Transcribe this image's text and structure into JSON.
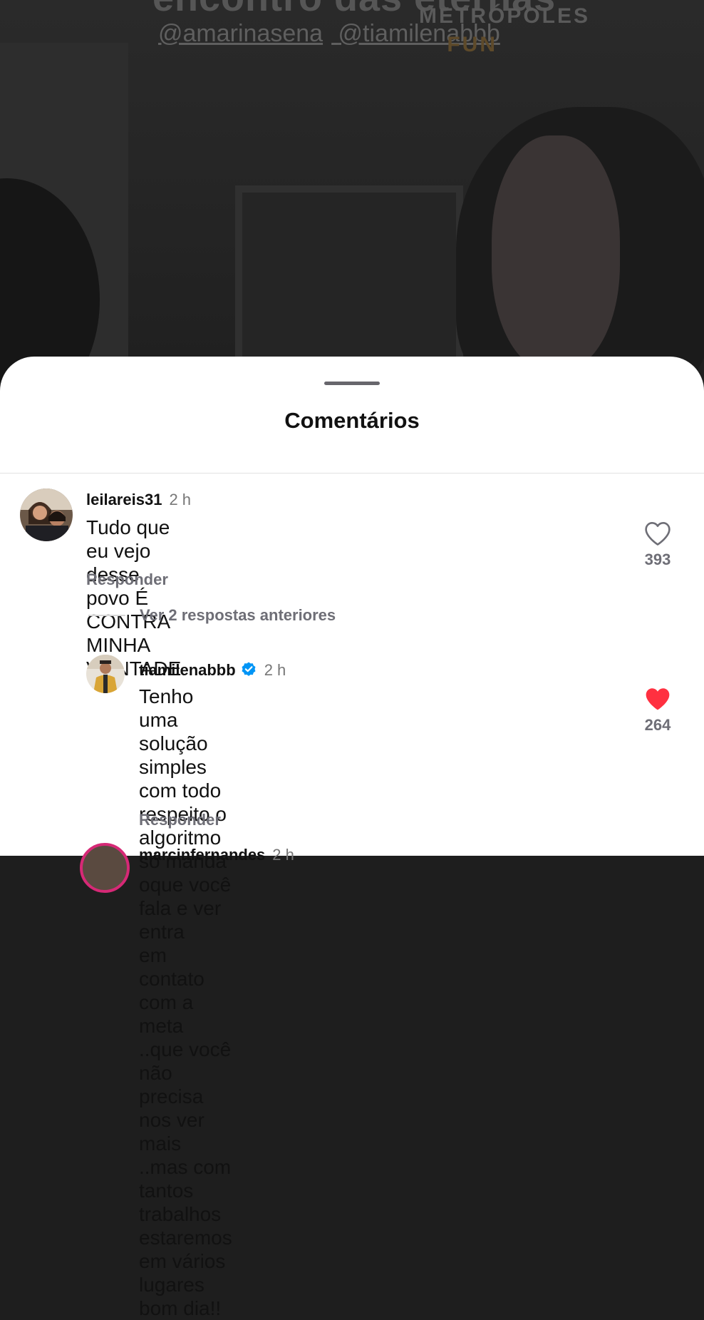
{
  "video": {
    "overlay_title": "encontro das eternas",
    "overlay_tags": [
      "@amarinasena",
      "@tiamilenabbb"
    ],
    "brand_name": "METRÓPOLES",
    "brand_sub": "FUN"
  },
  "sheet": {
    "title": "Comentários"
  },
  "comments": [
    {
      "username": "leilareis31",
      "time": "2 h",
      "text_lines": [
        "Tudo que eu vejo desse povo É CONTRA MINHA",
        "VONTADE"
      ],
      "reply_label": "Responder",
      "likes": "393",
      "liked": false
    }
  ],
  "view_replies_label": "Ver 2 respostas anteriores",
  "replies": [
    {
      "username": "tiamilenabbb",
      "verified": true,
      "time": "2 h",
      "text_lines": [
        "Tenho uma solução simples com todo respeito o",
        "algoritmo só manda oque você fala e ver entra",
        "em contato com a meta ..que você  não precisa",
        "nos ver mais ..mas com tantos trabalhos",
        "estaremos em vários lugares bom dia!!"
      ],
      "reply_label": "Responder",
      "likes": "264",
      "liked": true
    }
  ],
  "next_comment": {
    "username": "marcinfernandes",
    "time": "2 h"
  },
  "colors": {
    "like_active": "#ff3040",
    "verified_blue": "#0095f6",
    "muted_text": "#6e6e76"
  },
  "icons": [
    "heart-outline-icon",
    "heart-filled-icon",
    "verified-badge-icon"
  ]
}
